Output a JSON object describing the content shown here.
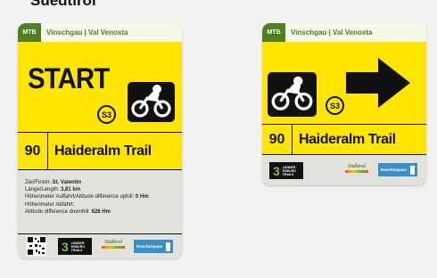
{
  "page": {
    "clipped_heading": "Suedtirol"
  },
  "sign_start": {
    "badge": "MTB",
    "area": "Vinschgau | Val Venosta",
    "headline": "START",
    "difficulty": "S3",
    "trail_number": "90",
    "trail_name": "Haideralm Trail",
    "info": [
      {
        "label": "Ziel/Finish: ",
        "value": "St. Valentin"
      },
      {
        "label": "Länge/Length: ",
        "value": "3,81 km"
      },
      {
        "label": "Höhenmeter Auffahrt/Altitude difference uphill: ",
        "value": "0 Hm"
      },
      {
        "label": "Höhenmeter Abfahrt:",
        "value": ""
      },
      {
        "label": "Altitude difference downhill: ",
        "value": "628 Hm"
      }
    ],
    "logos": {
      "three_big": "3",
      "three_small": [
        "LÄNDER",
        "ENDURO",
        "TRAILS"
      ],
      "suedtirol": "Südtirol",
      "reschenpass": "Reschenpass"
    }
  },
  "sign_arrow": {
    "badge": "MTB",
    "area": "Vinschgau | Val Venosta",
    "difficulty": "S3",
    "trail_number": "90",
    "trail_name": "Haideralm Trail",
    "logos": {
      "three_big": "3",
      "three_small": [
        "LÄNDER",
        "ENDURO",
        "TRAILS"
      ],
      "suedtirol": "Südtirol",
      "reschenpass": "Reschenpass"
    }
  },
  "colors": {
    "sign_yellow": "#ffe500",
    "mtb_green": "#4d7f23",
    "info_gray": "#e2e2dc",
    "text": "#111111"
  },
  "icons": [
    "mountain-bike-icon",
    "right-arrow-icon",
    "qr-code-icon",
    "reschenpass-figure-icon"
  ]
}
